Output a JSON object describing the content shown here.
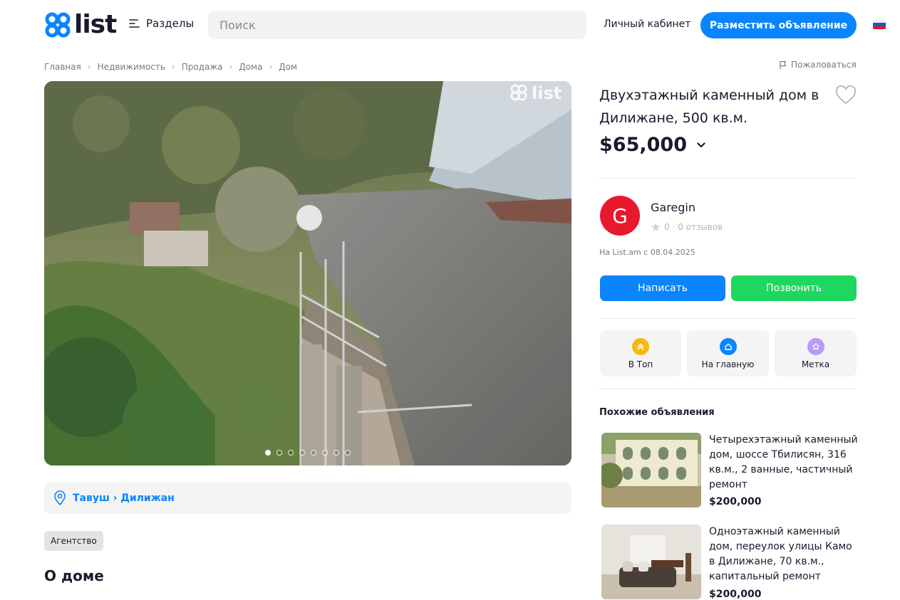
{
  "header": {
    "logo_text": "list",
    "sections_label": "Разделы",
    "search_placeholder": "Поиск",
    "cabinet_label": "Личный кабинет",
    "post_button_label": "Разместить объявление",
    "language_icon": "russian-flag-icon"
  },
  "breadcrumb": [
    "Главная",
    "Недвижимость",
    "Продажа",
    "Дома",
    "Дом"
  ],
  "report_label": "Пожаловаться",
  "gallery": {
    "watermark": "list",
    "photo_count": 8,
    "active_index": 0
  },
  "location": {
    "text": "Тавуш › Дилижан"
  },
  "tag": "Агентство",
  "about_heading": "О доме",
  "listing": {
    "title": "Двухэтажный каменный дом в Дилижане, 500 кв.м.",
    "price": "$65,000"
  },
  "seller": {
    "initial": "G",
    "name": "Garegin",
    "rating": "0 · 0 отзывов",
    "since": "На List.am с 08.04.2025"
  },
  "actions": {
    "write_label": "Написать",
    "call_label": "Позвонить"
  },
  "promo": [
    {
      "label": "В Топ",
      "icon": "double-chevron-up-icon",
      "color": "#f5b90f"
    },
    {
      "label": "На главную",
      "icon": "home-icon",
      "color": "#0a84ff"
    },
    {
      "label": "Метка",
      "icon": "star-icon",
      "color": "#b59cf7"
    }
  ],
  "similar": {
    "heading": "Похожие объявления",
    "items": [
      {
        "title": "Четырехэтажный каменный дом, шоссе Тбилисян, 316 кв.м., 2 ванные, частичный ремонт",
        "price": "$200,000"
      },
      {
        "title": "Одноэтажный каменный дом, переулок улицы Камо в Дилижане, 70 кв.м., капитальный ремонт",
        "price": "$200,000"
      }
    ]
  },
  "colors": {
    "accent": "#0a84ff",
    "call": "#1ed760",
    "avatar": "#e8192c"
  }
}
